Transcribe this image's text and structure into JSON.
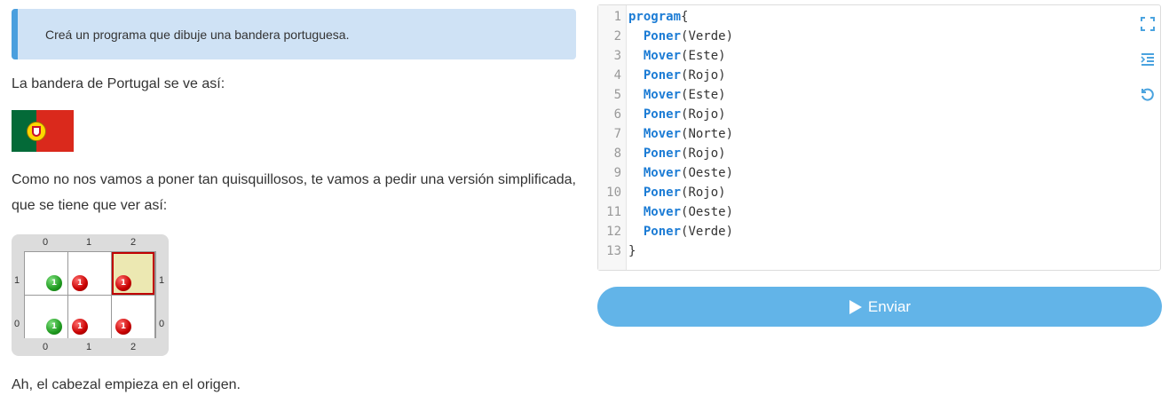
{
  "hint": "Creá un programa que dibuje una bandera portuguesa.",
  "intro": "La bandera de Portugal se ve así:",
  "description": "Como no nos vamos a poner tan quisquillosos, te vamos a pedir una versión simplificada, que se tiene que ver así:",
  "footer": "Ah, el cabezal empieza en el origen.",
  "board": {
    "col_labels": [
      "0",
      "1",
      "2"
    ],
    "row_labels": [
      "1",
      "0"
    ],
    "ball_count": "1",
    "colors": {
      "green": "#1f9a1f",
      "red": "#c80000",
      "cursor": "#c00000"
    },
    "cells": [
      {
        "col": 0,
        "row": 1,
        "ball": "green"
      },
      {
        "col": 1,
        "row": 1,
        "ball": "red"
      },
      {
        "col": 2,
        "row": 1,
        "ball": "red",
        "cursor": true
      },
      {
        "col": 0,
        "row": 0,
        "ball": "green"
      },
      {
        "col": 1,
        "row": 0,
        "ball": "red"
      },
      {
        "col": 2,
        "row": 0,
        "ball": "red"
      }
    ]
  },
  "editor": {
    "lines": [
      {
        "n": "1",
        "kw": "program",
        "rest": "{"
      },
      {
        "n": "2",
        "indent": "  ",
        "kw": "Poner",
        "rest": "(Verde)"
      },
      {
        "n": "3",
        "indent": "  ",
        "kw": "Mover",
        "rest": "(Este)"
      },
      {
        "n": "4",
        "indent": "  ",
        "kw": "Poner",
        "rest": "(Rojo)"
      },
      {
        "n": "5",
        "indent": "  ",
        "kw": "Mover",
        "rest": "(Este)"
      },
      {
        "n": "6",
        "indent": "  ",
        "kw": "Poner",
        "rest": "(Rojo)"
      },
      {
        "n": "7",
        "indent": "  ",
        "kw": "Mover",
        "rest": "(Norte)"
      },
      {
        "n": "8",
        "indent": "  ",
        "kw": "Poner",
        "rest": "(Rojo)"
      },
      {
        "n": "9",
        "indent": "  ",
        "kw": "Mover",
        "rest": "(Oeste)"
      },
      {
        "n": "10",
        "indent": "  ",
        "kw": "Poner",
        "rest": "(Rojo)"
      },
      {
        "n": "11",
        "indent": "  ",
        "kw": "Mover",
        "rest": "(Oeste)"
      },
      {
        "n": "12",
        "indent": "  ",
        "kw": "Poner",
        "rest": "(Verde)"
      },
      {
        "n": "13",
        "kw": "",
        "rest": "}"
      }
    ],
    "icons": [
      "fullscreen-icon",
      "indent-icon",
      "reset-icon"
    ]
  },
  "send_label": "Enviar",
  "accent": "#62b4e8"
}
